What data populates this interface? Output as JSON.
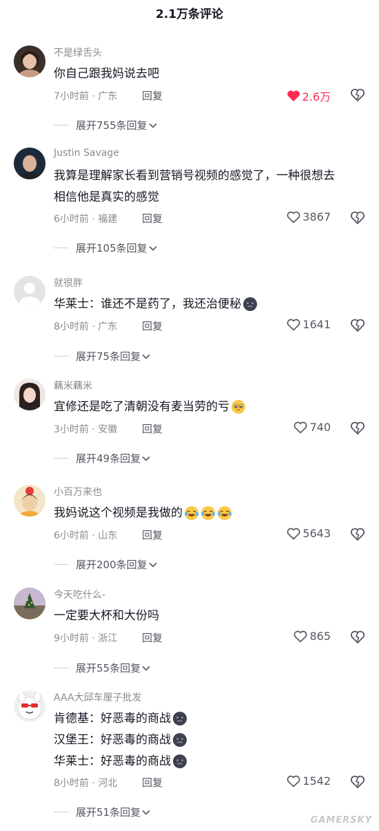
{
  "header": {
    "title": "2.1万条评论"
  },
  "comments": [
    {
      "username": "不是绿舌头",
      "lines": [
        "你自己跟我妈说去吧"
      ],
      "time_location": "7小时前 · 广东",
      "reply_label": "回复",
      "likes": "2.6万",
      "liked": true,
      "expand_label": "展开755条回复"
    },
    {
      "username": "Justin Savage",
      "lines": [
        "我算是理解家长看到营销号视频的感觉了，一种很想去",
        "相信他是真实的感觉"
      ],
      "time_location": "6小时前 · 福建",
      "reply_label": "回复",
      "likes": "3867",
      "liked": false,
      "expand_label": "展开105条回复"
    },
    {
      "username": "就很胖",
      "lines": [
        "华莱士：谁还不是药了，我还治便秘"
      ],
      "time_location": "8小时前 · 广东",
      "reply_label": "回复",
      "likes": "1641",
      "liked": false,
      "expand_label": "展开75条回复"
    },
    {
      "username": "藕米藕米",
      "lines": [
        "宜修还是吃了清朝没有麦当劳的亏"
      ],
      "time_location": "3小时前 · 安徽",
      "reply_label": "回复",
      "likes": "740",
      "liked": false,
      "expand_label": "展开49条回复"
    },
    {
      "username": "小百万来也",
      "lines": [
        "我妈说这个视频是我做的"
      ],
      "time_location": "6小时前 · 山东",
      "reply_label": "回复",
      "likes": "5643",
      "liked": false,
      "expand_label": "展开200条回复"
    },
    {
      "username": "今天吃什么-",
      "lines": [
        "一定要大杯和大份吗"
      ],
      "time_location": "9小时前 · 浙江",
      "reply_label": "回复",
      "likes": "865",
      "liked": false,
      "expand_label": "展开55条回复"
    },
    {
      "username": "AAA大邱车厘子批发",
      "lines": [
        "肯德基：好恶毒的商战",
        "汉堡王：好恶毒的商战",
        "华莱士：好恶毒的商战"
      ],
      "time_location": "8小时前 · 河北",
      "reply_label": "回复",
      "likes": "1542",
      "liked": false,
      "expand_label": "展开51条回复"
    }
  ],
  "watermark": "GAMERSKY",
  "colors": {
    "like_active": "#fe2c55",
    "text_primary": "#161823",
    "text_secondary": "#8a8b91"
  }
}
